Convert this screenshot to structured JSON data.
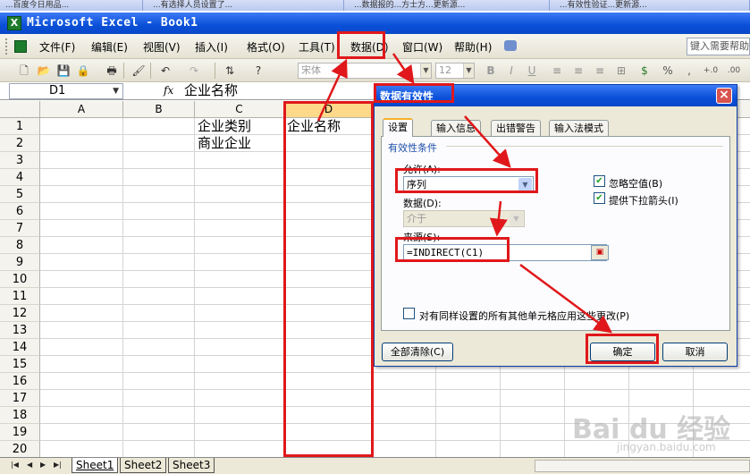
{
  "taskbar": {
    "tabs": [
      "...百度今日用品...",
      "...有选择人员设置了...",
      "...数据报的...方士方...更新源...",
      "...有效性验证...更新源..."
    ]
  },
  "window": {
    "title": "Microsoft Excel - Book1"
  },
  "menu": {
    "items": [
      "文件(F)",
      "编辑(E)",
      "视图(V)",
      "插入(I)",
      "格式(O)",
      "工具(T)",
      "数据(D)",
      "窗口(W)",
      "帮助(H)"
    ],
    "help_placeholder": "键入需要帮助"
  },
  "toolbar": {
    "font_name": "宋体",
    "font_size": "12",
    "bold": "B",
    "italic": "I",
    "underline": "U"
  },
  "formula_bar": {
    "name_box": "D1",
    "fx": "fx",
    "value": "企业名称"
  },
  "sheet": {
    "columns": [
      "A",
      "B",
      "C",
      "D"
    ],
    "rows": [
      "1",
      "2",
      "3",
      "4",
      "5",
      "6",
      "7",
      "8",
      "9",
      "10",
      "11",
      "12",
      "13",
      "14",
      "15",
      "16",
      "17",
      "18",
      "19",
      "20"
    ],
    "cells": {
      "C1": "企业类别",
      "C2": "商业企业",
      "D1": "企业名称"
    },
    "tabs": [
      "Sheet1",
      "Sheet2",
      "Sheet3"
    ]
  },
  "dialog": {
    "title": "数据有效性",
    "tabs": [
      "设置",
      "输入信息",
      "出错警告",
      "输入法模式"
    ],
    "group_title": "有效性条件",
    "allow_label": "允许(A):",
    "allow_value": "序列",
    "data_label": "数据(D):",
    "data_value": "介于",
    "source_label": "来源(S):",
    "source_value": "=INDIRECT(C1)",
    "ignore_blank_label": "忽略空值(B)",
    "dropdown_label": "提供下拉箭头(I)",
    "apply_all_label": "对有同样设置的所有其他单元格应用这些更改(P)",
    "clear_all_label": "全部清除(C)",
    "ok_label": "确定",
    "cancel_label": "取消"
  },
  "watermark": {
    "main": "Bai du 经验",
    "sub": "jingyan.baidu.com"
  }
}
